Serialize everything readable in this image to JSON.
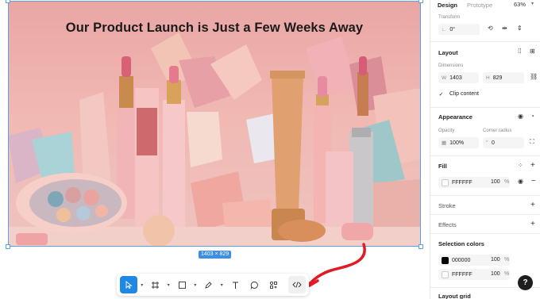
{
  "canvas": {
    "headline": "Our Product Launch is Just a Few Weeks Away",
    "dimensions_badge": "1403 × 829"
  },
  "toolbar": {
    "tools": [
      "move-icon",
      "frame-icon",
      "shape-icon",
      "pen-icon",
      "text-icon",
      "comment-icon",
      "components-icon",
      "dev-mode-icon"
    ]
  },
  "panel": {
    "tabs": {
      "design": "Design",
      "prototype": "Prototype"
    },
    "zoom": "63%",
    "transform": {
      "label": "Transform",
      "rotation": "0°"
    },
    "layout": {
      "title": "Layout",
      "dimensions_label": "Dimensions",
      "w_prefix": "W",
      "w_value": "1403",
      "h_prefix": "H",
      "h_value": "829",
      "clip_content": "Clip content"
    },
    "appearance": {
      "title": "Appearance",
      "opacity_label": "Opacity",
      "opacity_value": "100%",
      "radius_label": "Corner radius",
      "radius_value": "0"
    },
    "fill": {
      "title": "Fill",
      "hex": "FFFFFF",
      "opacity": "100",
      "pct": "%"
    },
    "stroke": {
      "title": "Stroke"
    },
    "effects": {
      "title": "Effects"
    },
    "selection_colors": {
      "title": "Selection colors",
      "items": [
        {
          "hex": "000000",
          "opacity": "100",
          "pct": "%",
          "color": "#000000"
        },
        {
          "hex": "FFFFFF",
          "opacity": "100",
          "pct": "%",
          "color": "#ffffff"
        }
      ]
    },
    "layout_grid": {
      "title": "Layout grid"
    },
    "help": "?"
  }
}
